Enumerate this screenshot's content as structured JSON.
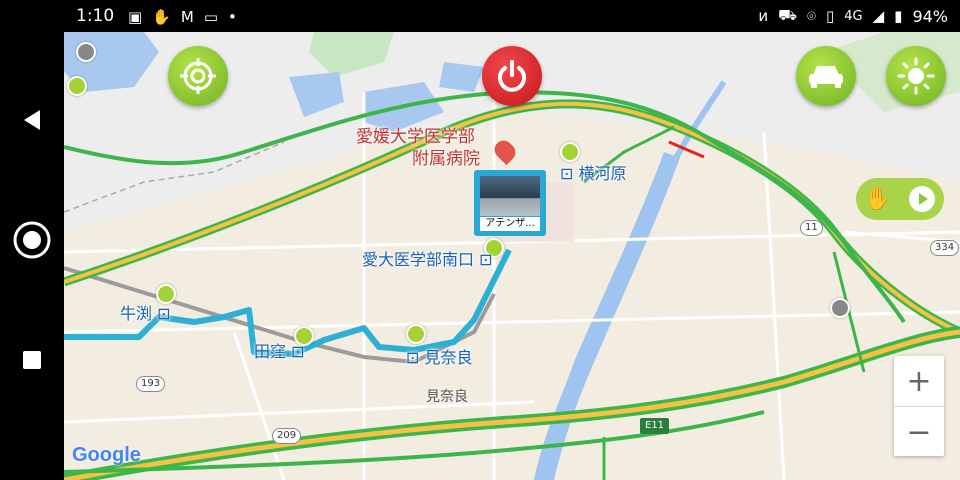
{
  "status_bar": {
    "time": "1:10",
    "network": "4G",
    "battery": "94%",
    "left_icons": [
      "image-icon",
      "hand-icon",
      "gmail-icon",
      "vr-icon",
      "dot-icon"
    ],
    "right_icons": [
      "nfc-icon",
      "car-wifi-icon",
      "location-icon",
      "vibrate-icon"
    ]
  },
  "nav_bar": {
    "buttons": [
      "back",
      "home",
      "recents"
    ]
  },
  "map": {
    "place_labels": {
      "hospital_line1": "愛媛大学医学部",
      "hospital_line2": "附属病院",
      "yokogawara": "横河原",
      "aidai_minamiguchi": "愛大医学部南口",
      "ushibuchi": "牛渕",
      "tabuku": "田窪",
      "mirai_station": "見奈良",
      "mirai_area": "見奈良"
    },
    "route_shields": [
      "11",
      "334",
      "193",
      "209",
      "E11"
    ],
    "photo_marker_caption": "アテンザ...",
    "attribution": "Google"
  },
  "controls": {
    "zoom_in": "+",
    "zoom_out": "−"
  },
  "colors": {
    "route": "#2eb0d4",
    "green_button": "#8cc63f",
    "power_button": "#e0262b",
    "traffic_green": "#3cb64a"
  }
}
